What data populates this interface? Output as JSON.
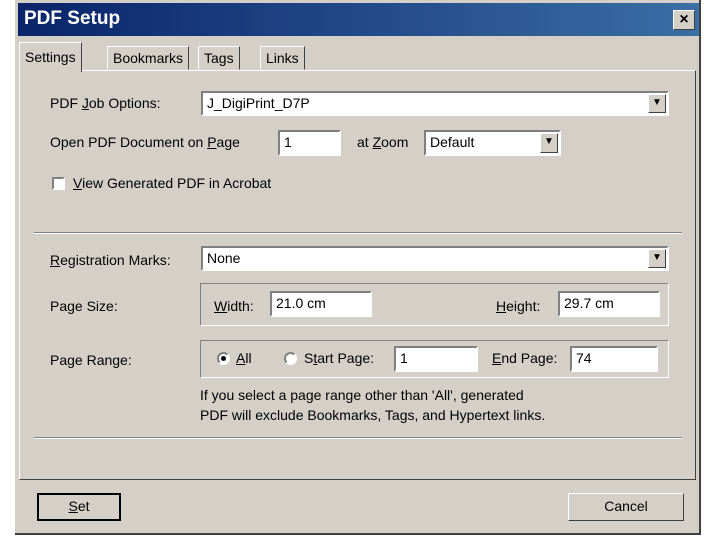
{
  "dialog": {
    "title": "PDF Setup",
    "close_glyph": "×"
  },
  "tabs": [
    "Settings",
    "Bookmarks",
    "Tags",
    "Links"
  ],
  "job_options": {
    "label_pre": "PDF ",
    "label_accel": "J",
    "label_post": "ob Options:",
    "value": "J_DigiPrint_D7P"
  },
  "open_page": {
    "label_pre": "Open PDF Document on ",
    "label_accel": "P",
    "label_post": "age",
    "value": "1"
  },
  "zoom": {
    "label_pre": "at ",
    "label_accel": "Z",
    "label_post": "oom",
    "value": "Default"
  },
  "view_in_acrobat": {
    "label_accel": "V",
    "label_post": "iew Generated PDF in Acrobat",
    "checked": false
  },
  "registration_marks": {
    "label_accel": "R",
    "label_post": "egistration Marks:",
    "value": "None"
  },
  "page_size": {
    "label": "Page Size:",
    "width_label_accel": "W",
    "width_label_post": "idth:",
    "width_value": "21.0 cm",
    "height_label_accel": "H",
    "height_label_post": "eight:",
    "height_value": "29.7 cm"
  },
  "page_range": {
    "label": "Page Range:",
    "all_label_accel": "A",
    "all_label_post": "ll",
    "all_selected": true,
    "start_label_pre": "S",
    "start_label_accel": "t",
    "start_label_post": "art Page:",
    "start_value": "1",
    "end_label_accel": "E",
    "end_label_post": "nd Page:",
    "end_value": "74",
    "note_line1": "If you select a page range other than 'All', generated",
    "note_line2": "PDF will exclude Bookmarks, Tags, and Hypertext links."
  },
  "buttons": {
    "set_accel": "S",
    "set_post": "et",
    "cancel": "Cancel"
  },
  "icons": {
    "dropdown": "chevron-down-icon",
    "close": "close-icon"
  }
}
